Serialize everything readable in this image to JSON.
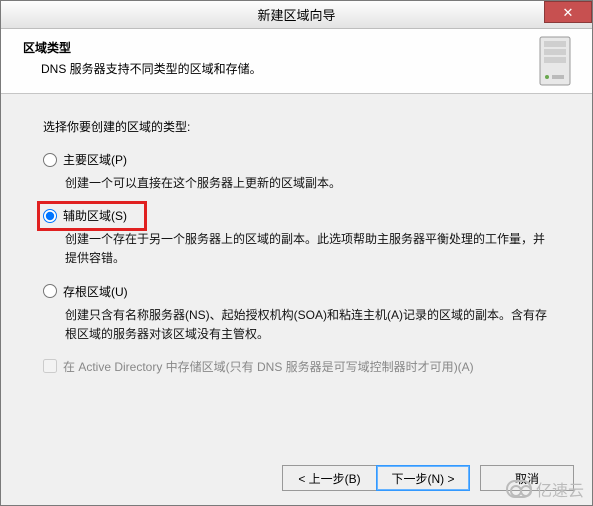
{
  "window": {
    "title": "新建区域向导",
    "close_label": "✕"
  },
  "header": {
    "title": "区域类型",
    "subtitle": "DNS 服务器支持不同类型的区域和存储。"
  },
  "content": {
    "prompt": "选择你要创建的区域的类型:",
    "options": [
      {
        "label": "主要区域(P)",
        "desc": "创建一个可以直接在这个服务器上更新的区域副本。",
        "checked": false
      },
      {
        "label": "辅助区域(S)",
        "desc": "创建一个存在于另一个服务器上的区域的副本。此选项帮助主服务器平衡处理的工作量，并提供容错。",
        "checked": true,
        "highlighted": true
      },
      {
        "label": "存根区域(U)",
        "desc": "创建只含有名称服务器(NS)、起始授权机构(SOA)和粘连主机(A)记录的区域的副本。含有存根区域的服务器对该区域没有主管权。",
        "checked": false
      }
    ],
    "checkbox": {
      "label": "在 Active Directory 中存储区域(只有 DNS 服务器是可写域控制器时才可用)(A)",
      "checked": false,
      "disabled": true
    }
  },
  "buttons": {
    "back": "< 上一步(B)",
    "next": "下一步(N) >",
    "cancel": "取消"
  },
  "watermark": {
    "text": "亿速云"
  }
}
